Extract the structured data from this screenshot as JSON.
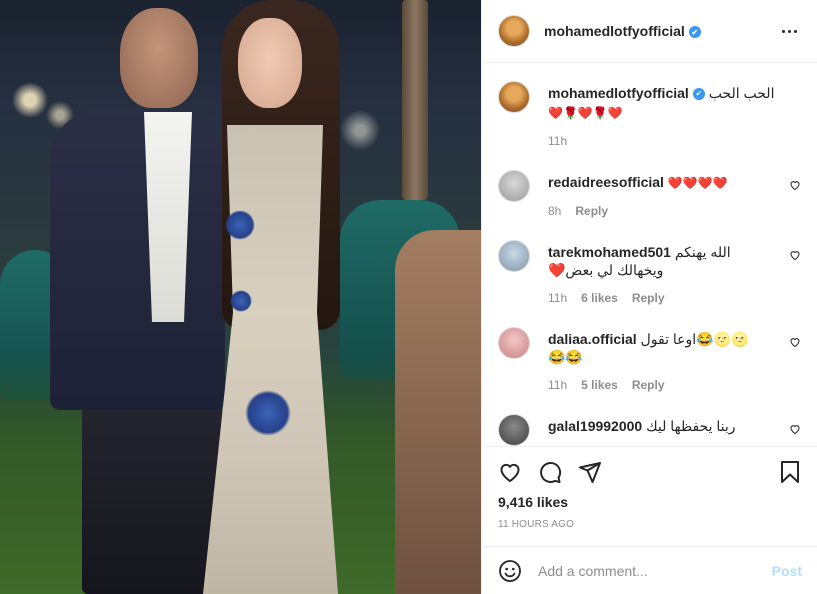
{
  "post": {
    "username": "mohamedlotfyofficial",
    "more_icon": "more-horizontal-icon"
  },
  "caption": {
    "username": "mohamedlotfyofficial",
    "text": "الحب الحب",
    "emoji_line": "❤️🌹❤️🌹❤️",
    "time": "11h"
  },
  "comments": [
    {
      "username": "redaidreesofficial",
      "text": "❤️❤️❤️❤️",
      "time": "8h",
      "likes": "",
      "reply": "Reply"
    },
    {
      "username": "tarekmohamed501",
      "text": "الله يهنكم",
      "text2": "ويخهالك لي بعض❤️",
      "time": "11h",
      "likes": "6 likes",
      "reply": "Reply"
    },
    {
      "username": "daliaa.official",
      "text": "اوعا تقول😂🌝🌝",
      "text2": "😂😂",
      "time": "11h",
      "likes": "5 likes",
      "reply": "Reply"
    },
    {
      "username": "galal19992000",
      "text": "ربنا يحفظها ليك"
    }
  ],
  "actions": {
    "likes": "9,416 likes",
    "time": "11 HOURS AGO"
  },
  "add_comment": {
    "placeholder": "Add a comment...",
    "post_label": "Post"
  },
  "colors": {
    "verified": "#3897f0",
    "post_button": "#b2dffc",
    "muted_text": "#8e8e8e"
  }
}
